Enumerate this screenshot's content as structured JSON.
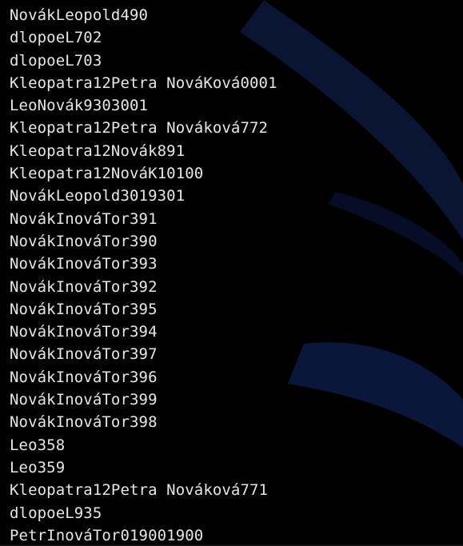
{
  "colors": {
    "background": "#000000",
    "text": "#e6e6e6",
    "wallpaper_accent": "#0d1a45"
  },
  "terminal": {
    "lines": [
      "NovákLeopold490",
      "dlopoeL702",
      "dlopoeL703",
      "Kleopatra12Petra NováKová0001",
      "LeoNovák9303001",
      "Kleopatra12Petra Nováková772",
      "Kleopatra12Novák891",
      "Kleopatra12NováK10100",
      "NovákLeopold3019301",
      "NovákInováTor391",
      "NovákInováTor390",
      "NovákInováTor393",
      "NovákInováTor392",
      "NovákInováTor395",
      "NovákInováTor394",
      "NovákInováTor397",
      "NovákInováTor396",
      "NovákInováTor399",
      "NovákInováTor398",
      "Leo358",
      "Leo359",
      "Kleopatra12Petra Nováková771",
      "dlopoeL935",
      "PetrInováTor019001900"
    ]
  }
}
